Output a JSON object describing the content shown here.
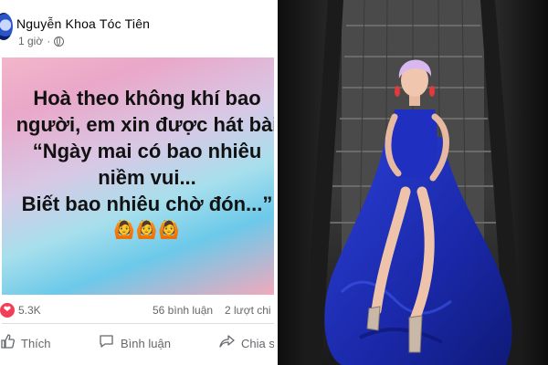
{
  "post": {
    "author": "Nguyễn Khoa Tóc Tiên",
    "time": "1 giờ",
    "text_lines": [
      "Hoà theo không khí bao",
      "người, em xin được hát bài",
      "“Ngày mai có bao nhiêu",
      "niềm vui...",
      "Biết bao nhiêu chờ đón...”"
    ],
    "emojis": "🙆🙆🙆",
    "reactions_count": "5.3K",
    "comments_text": "56 bình luận",
    "shares_text": "2 lượt chi",
    "actions": {
      "like": "Thích",
      "comment": "Bình luận",
      "share": "Chia s"
    },
    "colors": {
      "reaction_heart": "#f33e58",
      "secondary_text": "#65676b"
    }
  },
  "photo": {
    "description_icon": "escalator-photo",
    "colors": {
      "dress": "#1d2fb8",
      "hair": "#d9b8f0"
    }
  }
}
